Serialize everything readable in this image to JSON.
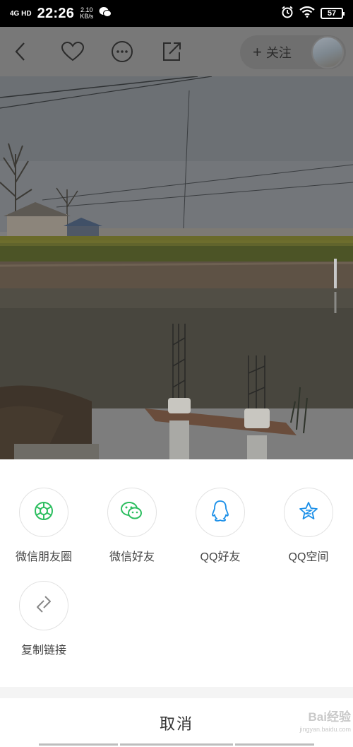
{
  "status_bar": {
    "network": "4G HD",
    "time": "22:26",
    "speed_value": "2.10",
    "speed_unit": "KB/s",
    "battery": "57"
  },
  "top_bar": {
    "follow_label": "关注",
    "follow_prefix": "+"
  },
  "share_sheet": {
    "items": [
      {
        "label": "微信朋友圈",
        "icon": "wechat-moments-icon",
        "color": "#2dbe60"
      },
      {
        "label": "微信好友",
        "icon": "wechat-icon",
        "color": "#2dbe60"
      },
      {
        "label": "QQ好友",
        "icon": "qq-icon",
        "color": "#1a8fe8"
      },
      {
        "label": "QQ空间",
        "icon": "qzone-icon",
        "color": "#1a8fe8"
      },
      {
        "label": "复制链接",
        "icon": "link-icon",
        "color": "#888888"
      }
    ],
    "cancel_label": "取消"
  },
  "watermark": {
    "brand": "Bai经验",
    "site": "jingyan.baidu.com"
  }
}
